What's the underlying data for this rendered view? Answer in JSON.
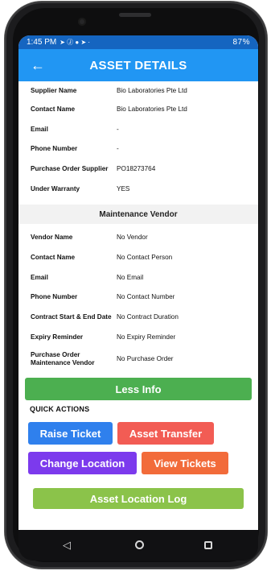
{
  "status": {
    "time": "1:45 PM",
    "icons_left": "➤ Ⓙ ● ➤ ·",
    "battery": "87%"
  },
  "appbar": {
    "title": "ASSET DETAILS",
    "back_glyph": "←"
  },
  "supplier": {
    "rows": [
      {
        "label": "Supplier Name",
        "value": "Bio Laboratories Pte Ltd"
      },
      {
        "label": "Contact Name",
        "value": "Bio Laboratories Pte Ltd"
      },
      {
        "label": "Email",
        "value": "-"
      },
      {
        "label": "Phone Number",
        "value": "-"
      },
      {
        "label": "Purchase Order Supplier",
        "value": "PO18273764"
      },
      {
        "label": "Under Warranty",
        "value": "YES"
      }
    ]
  },
  "maintenance": {
    "heading": "Maintenance Vendor",
    "rows": [
      {
        "label": "Vendor Name",
        "value": "No Vendor"
      },
      {
        "label": "Contact Name",
        "value": "No Contact Person"
      },
      {
        "label": "Email",
        "value": "No Email"
      },
      {
        "label": "Phone Number",
        "value": "No Contact Number"
      },
      {
        "label": "Contract Start & End Date",
        "value": "No Contract Duration"
      },
      {
        "label": "Expiry Reminder",
        "value": "No Expiry Reminder"
      },
      {
        "label": "Purchase Order Maintenance Vendor",
        "value": "No Purchase Order"
      }
    ]
  },
  "actions": {
    "less_info": "Less Info",
    "quick_actions_label": "QUICK ACTIONS",
    "raise_ticket": "Raise Ticket",
    "asset_transfer": "Asset Transfer",
    "change_location": "Change Location",
    "view_tickets": "View Tickets",
    "asset_location_log": "Asset Location Log"
  },
  "navbar": {
    "back": "◁"
  },
  "colors": {
    "appbar": "#2196f3",
    "statusbar": "#1565c0",
    "less_info": "#4caf50",
    "raise_ticket": "#2f80ed",
    "asset_transfer": "#f25c54",
    "change_location": "#7c3aed",
    "view_tickets": "#f26b3a",
    "asset_location_log": "#8bc34a"
  }
}
